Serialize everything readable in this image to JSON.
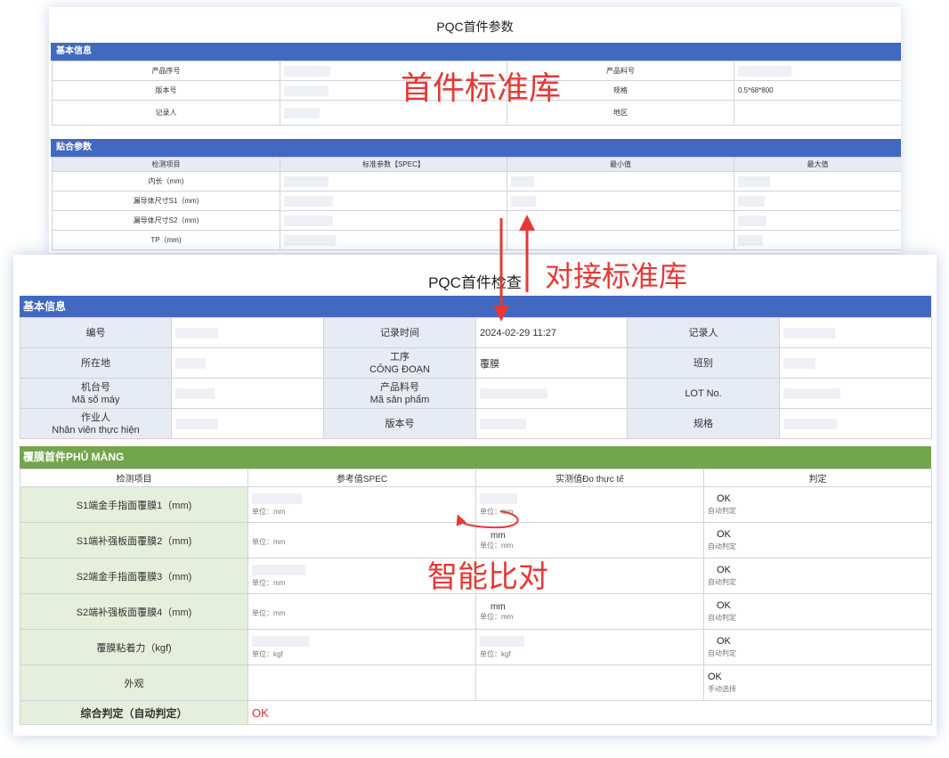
{
  "back": {
    "title": "PQC首件参数",
    "section1": "基本信息",
    "info_rows": [
      {
        "l1": "产品序号",
        "l2": "产品料号",
        "v2": ""
      },
      {
        "l1": "版本号",
        "l2": "规格",
        "v2": "0.5*68*800"
      },
      {
        "l1": "记录人",
        "l2": "地区",
        "v2": ""
      }
    ],
    "section2": "贴合参数",
    "param_headers": [
      "检测项目",
      "标准参数【SPEC】",
      "最小值",
      "最大值"
    ],
    "param_rows": [
      "内长（mm)",
      "漏导体尺寸S1（mm)",
      "漏导体尺寸S2（mm)",
      "TP（mm)"
    ]
  },
  "front": {
    "title": "PQC首件检查",
    "section1": "基本信息",
    "info": {
      "serial_label": "编号",
      "record_time_label": "记录时间",
      "record_time_value": "2024-02-29 11:27",
      "recorder_label": "记录人",
      "location_label": "所在地",
      "process_label_cn": "工序",
      "process_label_vn": "CÔNG ĐOẠN",
      "process_value": "覆膜",
      "shift_label": "班别",
      "machine_label_cn": "机台号",
      "machine_label_vn": "Mã số máy",
      "product_label_cn": "产品料号",
      "product_label_vn": "Mã sản phẩm",
      "lot_label": "LOT No.",
      "operator_label_cn": "作业人",
      "operator_label_vn": "Nhân viên thực hiện",
      "version_label": "版本号",
      "spec_label": "规格"
    },
    "section2": "覆膜首件PHỦ MÀNG",
    "film_headers": [
      "检测项目",
      "参考值SPEC",
      "实测值Đo thực tế",
      "判定"
    ],
    "film_rows": [
      {
        "item": "S1端金手指面覆膜1（mm)",
        "ref_unit": "单位：mm",
        "meas_mm": "",
        "meas_unit": "单位：mm",
        "result": "OK",
        "mode": "自动判定"
      },
      {
        "item": "S1端补强板面覆膜2（mm)",
        "ref_unit": "单位：mm",
        "meas_mm": "mm",
        "meas_unit": "单位：mm",
        "result": "OK",
        "mode": "自动判定"
      },
      {
        "item": "S2端金手指面覆膜3（mm)",
        "ref_unit": "单位：mm",
        "meas_mm": "",
        "meas_unit": "",
        "result": "OK",
        "mode": "自动判定"
      },
      {
        "item": "S2端补强板面覆膜4（mm)",
        "ref_unit": "单位：mm",
        "meas_mm": "mm",
        "meas_unit": "单位：mm",
        "result": "OK",
        "mode": "自动判定"
      },
      {
        "item": "覆膜粘着力（kgf)",
        "ref_unit": "单位：kgf",
        "meas_mm": "",
        "meas_unit": "单位：kgf",
        "result": "OK",
        "mode": "自动判定"
      },
      {
        "item": "外观",
        "ref_unit": "",
        "meas_mm": "",
        "meas_unit": "",
        "result": "OK",
        "mode": "手动选择"
      }
    ],
    "final_label": "综合判定（自动判定）",
    "final_value": "OK"
  },
  "annotations": {
    "standard_library": "首件标准库",
    "connect_library": "对接标准库",
    "smart_compare": "智能比对"
  },
  "colors": {
    "section_blue": "#4169c1",
    "section_green": "#73a64c",
    "annotation_red": "#e53935",
    "final_ok_red": "#e02c2c"
  }
}
